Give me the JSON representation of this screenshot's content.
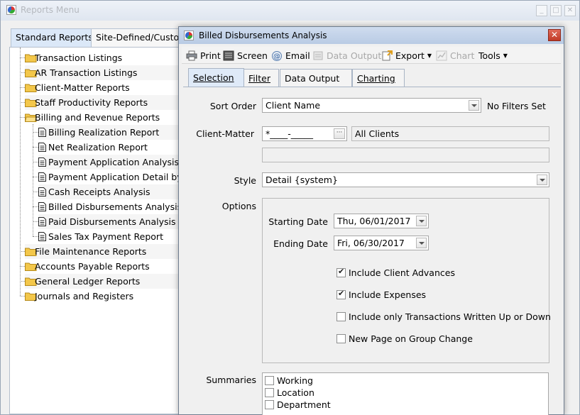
{
  "outer": {
    "title": "Reports Menu",
    "tabs": [
      "Standard Reports",
      "Site-Defined/Custom"
    ],
    "tree": [
      {
        "label": "Transaction Listings",
        "kind": "folder",
        "level": 0
      },
      {
        "label": "AR Transaction Listings",
        "kind": "folder",
        "level": 0
      },
      {
        "label": "Client-Matter Reports",
        "kind": "folder",
        "level": 0
      },
      {
        "label": "Staff Productivity Reports",
        "kind": "folder",
        "level": 0
      },
      {
        "label": "Billing and Revenue Reports",
        "kind": "folder-open",
        "level": 0
      },
      {
        "label": "Billing Realization Report",
        "kind": "doc",
        "level": 1
      },
      {
        "label": "Net Realization Report",
        "kind": "doc",
        "level": 1
      },
      {
        "label": "Payment Application Analysis",
        "kind": "doc",
        "level": 1
      },
      {
        "label": "Payment Application Detail by",
        "kind": "doc",
        "level": 1
      },
      {
        "label": "Cash Receipts Analysis",
        "kind": "doc",
        "level": 1
      },
      {
        "label": "Billed Disbursements Analysis",
        "kind": "doc",
        "level": 1
      },
      {
        "label": "Paid Disbursements Analysis",
        "kind": "doc",
        "level": 1
      },
      {
        "label": "Sales Tax Payment Report",
        "kind": "doc",
        "level": 1
      },
      {
        "label": "File Maintenance Reports",
        "kind": "folder",
        "level": 0
      },
      {
        "label": "Accounts Payable Reports",
        "kind": "folder",
        "level": 0
      },
      {
        "label": "General Ledger Reports",
        "kind": "folder",
        "level": 0
      },
      {
        "label": "Journals and Registers",
        "kind": "folder",
        "level": 0
      }
    ]
  },
  "dialog": {
    "title": "Billed Disbursements Analysis",
    "close_glyph": "✕",
    "toolbar": {
      "print": "Print",
      "screen": "Screen",
      "email": "Email",
      "data_output": "Data Output",
      "export": "Export",
      "chart": "Chart",
      "tools": "Tools"
    },
    "tabs": {
      "selection": "Selection",
      "filter": "Filter",
      "data_output": "Data Output",
      "charting": "Charting"
    },
    "form": {
      "sort_order_label": "Sort Order",
      "sort_order_value": "Client Name",
      "filters_status": "No Filters Set",
      "client_matter_label": "Client-Matter",
      "client_matter_value": "*____-_____",
      "client_matter_desc": "All Clients",
      "client_matter_desc2": "",
      "style_label": "Style",
      "style_value": "Detail {system}",
      "options_label": "Options",
      "starting_date_label": "Starting Date",
      "starting_date_value": "Thu, 06/01/2017",
      "ending_date_label": "Ending Date",
      "ending_date_value": "Fri, 06/30/2017",
      "checkboxes": [
        {
          "label": "Include Client Advances",
          "checked": true
        },
        {
          "label": "Include Expenses",
          "checked": true
        },
        {
          "label": "Include only Transactions Written Up or Down",
          "checked": false
        },
        {
          "label": "New Page on Group Change",
          "checked": false
        }
      ],
      "summaries_label": "Summaries",
      "summaries": [
        {
          "label": "Working",
          "checked": false
        },
        {
          "label": "Location",
          "checked": false
        },
        {
          "label": "Department",
          "checked": false
        }
      ]
    }
  },
  "colors": {
    "folder": "#f3c74a",
    "tab_active": "#dbe8f8",
    "close_red": "#c13a27"
  }
}
